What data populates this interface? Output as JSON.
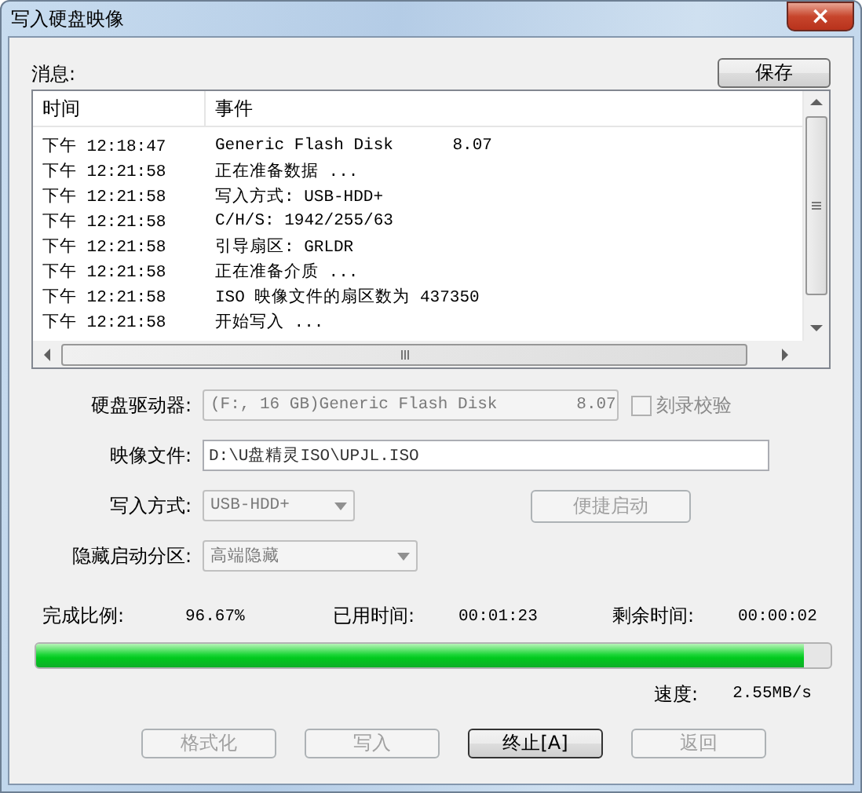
{
  "window": {
    "title": "写入硬盘映像",
    "close": "×"
  },
  "messages": {
    "label": "消息:",
    "save_button": {
      "label": "保存",
      "disabled": false
    },
    "columns": [
      "时间",
      "事件"
    ],
    "rows": [
      {
        "time": "下午 12:18:47",
        "event": "Generic Flash Disk      8.07"
      },
      {
        "time": "下午 12:21:58",
        "event": "正在准备数据 ..."
      },
      {
        "time": "下午 12:21:58",
        "event": "写入方式: USB-HDD+"
      },
      {
        "time": "下午 12:21:58",
        "event": "C/H/S: 1942/255/63"
      },
      {
        "time": "下午 12:21:58",
        "event": "引导扇区: GRLDR"
      },
      {
        "time": "下午 12:21:58",
        "event": "正在准备介质 ..."
      },
      {
        "time": "下午 12:21:58",
        "event": "ISO 映像文件的扇区数为 437350"
      },
      {
        "time": "下午 12:21:58",
        "event": "开始写入 ..."
      }
    ]
  },
  "form": [
    {
      "kind": "combo",
      "label": "硬盘驱动器:",
      "value": "(F:, 16 GB)Generic Flash Disk        8.07",
      "disabled": true,
      "checkbox": {
        "label": "刻录校验",
        "checked": false,
        "disabled": true
      }
    },
    {
      "kind": "input",
      "label": "映像文件:",
      "value": "D:\\U盘精灵ISO\\UPJL.ISO",
      "disabled": false
    },
    {
      "kind": "combo",
      "label": "写入方式:",
      "value": "USB-HDD+",
      "disabled": true,
      "button": {
        "label": "便捷启动",
        "disabled": true
      }
    },
    {
      "kind": "combo",
      "label": "隐藏启动分区:",
      "value": "高端隐藏",
      "disabled": true
    }
  ],
  "progress": {
    "done_label": "完成比例:",
    "done": "96.67%",
    "elapsed_label": "已用时间:",
    "elapsed": "00:01:23",
    "remaining_label": "剩余时间:",
    "remaining": "00:00:02",
    "level": 0.967,
    "speed_label": "速度:",
    "speed": "2.55MB/s"
  },
  "buttons": [
    {
      "label": "格式化",
      "disabled": true,
      "focused": false
    },
    {
      "label": "写入",
      "disabled": true,
      "focused": false
    },
    {
      "label": "终止[A]",
      "disabled": false,
      "focused": true
    },
    {
      "label": "返回",
      "disabled": true,
      "focused": false
    }
  ]
}
